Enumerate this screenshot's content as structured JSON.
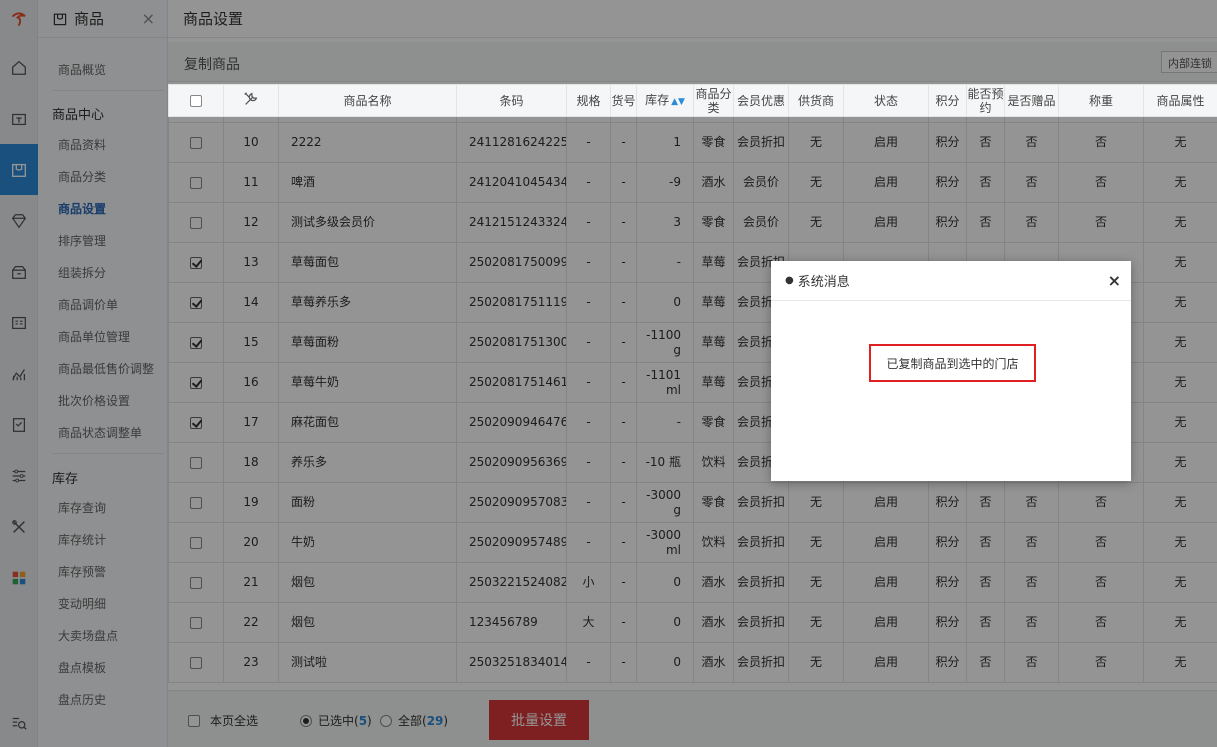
{
  "sidebar": {
    "title": "商品",
    "close": "×",
    "items": [
      {
        "label": "商品概览"
      },
      {
        "label": "商品中心"
      },
      {
        "label": "商品资料"
      },
      {
        "label": "商品分类"
      },
      {
        "label": "商品设置"
      },
      {
        "label": "排序管理"
      },
      {
        "label": "组装拆分"
      },
      {
        "label": "商品调价单"
      },
      {
        "label": "商品单位管理"
      },
      {
        "label": "商品最低售价调整"
      },
      {
        "label": "批次价格设置"
      },
      {
        "label": "商品状态调整单"
      },
      {
        "label": "库存"
      },
      {
        "label": "库存查询"
      },
      {
        "label": "库存统计"
      },
      {
        "label": "库存预警"
      },
      {
        "label": "变动明细"
      },
      {
        "label": "大卖场盘点"
      },
      {
        "label": "盘点模板"
      },
      {
        "label": "盘点历史"
      }
    ]
  },
  "page": {
    "title": "商品设置",
    "section_title": "复制商品",
    "right_button": "内部连锁"
  },
  "table": {
    "headers": [
      "商品名称",
      "条码",
      "规格",
      "货号",
      "库存",
      "商品分类",
      "会员优惠",
      "供货商",
      "状态",
      "积分",
      "能否预约",
      "是否赠品",
      "称重",
      "商品属性"
    ],
    "rows": [
      {
        "no": "10",
        "name": "2222",
        "barcode": "2411281624225",
        "spec": "-",
        "code": "-",
        "stock": "1",
        "cat": "零食",
        "discount": "会员折扣",
        "supplier": "无",
        "status": "启用",
        "points": "积分",
        "reserve": "否",
        "gift": "否",
        "weigh": "否",
        "attr": "无",
        "checked": false
      },
      {
        "no": "11",
        "name": "啤酒",
        "barcode": "2412041045434",
        "spec": "-",
        "code": "-",
        "stock": "-9",
        "cat": "酒水",
        "discount": "会员价",
        "supplier": "无",
        "status": "启用",
        "points": "积分",
        "reserve": "否",
        "gift": "否",
        "weigh": "否",
        "attr": "无",
        "checked": false
      },
      {
        "no": "12",
        "name": "测试多级会员价",
        "barcode": "2412151243324",
        "spec": "-",
        "code": "-",
        "stock": "3",
        "cat": "零食",
        "discount": "会员价",
        "supplier": "无",
        "status": "启用",
        "points": "积分",
        "reserve": "否",
        "gift": "否",
        "weigh": "否",
        "attr": "无",
        "checked": false
      },
      {
        "no": "13",
        "name": "草莓面包",
        "barcode": "2502081750099",
        "spec": "-",
        "code": "-",
        "stock": "-",
        "cat": "草莓",
        "discount": "会员折扣",
        "supplier": "",
        "status": "",
        "points": "",
        "reserve": "",
        "gift": "",
        "weigh": "",
        "attr": "无",
        "checked": true
      },
      {
        "no": "14",
        "name": "草莓养乐多",
        "barcode": "2502081751119",
        "spec": "-",
        "code": "-",
        "stock": "0",
        "cat": "草莓",
        "discount": "会员折扣",
        "supplier": "",
        "status": "",
        "points": "",
        "reserve": "",
        "gift": "",
        "weigh": "",
        "attr": "无",
        "checked": true
      },
      {
        "no": "15",
        "name": "草莓面粉",
        "barcode": "2502081751300",
        "spec": "-",
        "code": "-",
        "stock": "-1100 g",
        "cat": "草莓",
        "discount": "会员折扣",
        "supplier": "",
        "status": "",
        "points": "",
        "reserve": "",
        "gift": "",
        "weigh": "",
        "attr": "无",
        "checked": true
      },
      {
        "no": "16",
        "name": "草莓牛奶",
        "barcode": "2502081751461",
        "spec": "-",
        "code": "-",
        "stock": "-1101 ml",
        "cat": "草莓",
        "discount": "会员折扣",
        "supplier": "",
        "status": "",
        "points": "",
        "reserve": "",
        "gift": "",
        "weigh": "",
        "attr": "无",
        "checked": true
      },
      {
        "no": "17",
        "name": "麻花面包",
        "barcode": "2502090946476",
        "spec": "-",
        "code": "-",
        "stock": "-",
        "cat": "零食",
        "discount": "会员折扣",
        "supplier": "",
        "status": "",
        "points": "",
        "reserve": "",
        "gift": "",
        "weigh": "",
        "attr": "无",
        "checked": true
      },
      {
        "no": "18",
        "name": "养乐多",
        "barcode": "2502090956369",
        "spec": "-",
        "code": "-",
        "stock": "-10 瓶",
        "cat": "饮料",
        "discount": "会员折扣",
        "supplier": "",
        "status": "",
        "points": "",
        "reserve": "",
        "gift": "",
        "weigh": "",
        "attr": "无",
        "checked": false
      },
      {
        "no": "19",
        "name": "面粉",
        "barcode": "2502090957083",
        "spec": "-",
        "code": "-",
        "stock": "-3000 g",
        "cat": "零食",
        "discount": "会员折扣",
        "supplier": "无",
        "status": "启用",
        "points": "积分",
        "reserve": "否",
        "gift": "否",
        "weigh": "否",
        "attr": "无",
        "checked": false
      },
      {
        "no": "20",
        "name": "牛奶",
        "barcode": "2502090957489",
        "spec": "-",
        "code": "-",
        "stock": "-3000 ml",
        "cat": "饮料",
        "discount": "会员折扣",
        "supplier": "无",
        "status": "启用",
        "points": "积分",
        "reserve": "否",
        "gift": "否",
        "weigh": "否",
        "attr": "无",
        "checked": false
      },
      {
        "no": "21",
        "name": "烟包",
        "barcode": "2503221524082",
        "spec": "小",
        "code": "-",
        "stock": "0",
        "cat": "酒水",
        "discount": "会员折扣",
        "supplier": "无",
        "status": "启用",
        "points": "积分",
        "reserve": "否",
        "gift": "否",
        "weigh": "否",
        "attr": "无",
        "checked": false
      },
      {
        "no": "22",
        "name": "烟包",
        "barcode": "123456789",
        "spec": "大",
        "code": "-",
        "stock": "0",
        "cat": "酒水",
        "discount": "会员折扣",
        "supplier": "无",
        "status": "启用",
        "points": "积分",
        "reserve": "否",
        "gift": "否",
        "weigh": "否",
        "attr": "无",
        "checked": false
      },
      {
        "no": "23",
        "name": "测试啦",
        "barcode": "2503251834014",
        "spec": "-",
        "code": "-",
        "stock": "0",
        "cat": "酒水",
        "discount": "会员折扣",
        "supplier": "无",
        "status": "启用",
        "points": "积分",
        "reserve": "否",
        "gift": "否",
        "weigh": "否",
        "attr": "无",
        "checked": false
      }
    ]
  },
  "footer": {
    "select_page": "本页全选",
    "selected_label": "已选中(",
    "selected_count": "5",
    "all_label": "全部(",
    "all_count": "29",
    "close_paren": ")",
    "batch_button": "批量设置"
  },
  "dialog": {
    "title": "系统消息",
    "dot": "●",
    "close": "×",
    "message": "已复制商品到选中的门店"
  },
  "colors": {
    "accent": "#2c8ad8",
    "danger": "#d9383a",
    "highlight": "#e02020"
  }
}
